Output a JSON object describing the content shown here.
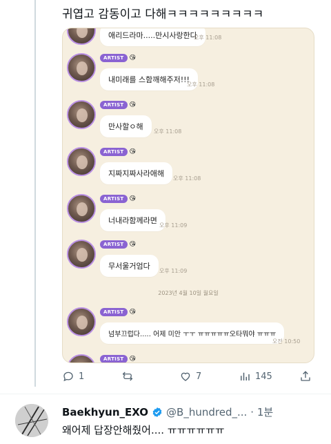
{
  "tweet": {
    "text": "귀엽고 감동이고 다해ㅋㅋㅋㅋㅋㅋㅋㅋㅋ"
  },
  "chat": {
    "badge_label": "ARTIST",
    "badge_emoji": "😘",
    "messages": [
      {
        "text": "애리드라마.....만시사랑한다",
        "time": "오후 11:08"
      },
      {
        "text": "내미래를 스함깨해주저!!!",
        "time": "오후 11:08"
      },
      {
        "text": "만사할ㅇ해",
        "time": "오후 11:08"
      },
      {
        "text": "지짜지짜사라애해",
        "time": "오후 11:08"
      },
      {
        "text": "너내라함께라면",
        "time": "오후 11:09"
      },
      {
        "text": "무서울거엄다",
        "time": "오후 11:09"
      },
      {
        "text": "넘부끄럽다..... 어제 미안 ㅜㅜ ㅠㅠㅠㅠㅠ오타뭐야 ㅠㅠㅠ",
        "time": "오전 10:50"
      }
    ],
    "date_separator": "2023년 4월 10일 월요일"
  },
  "actions": {
    "replies": "1",
    "retweets": "",
    "likes": "7",
    "views": "145"
  },
  "reply": {
    "name": "Baekhyun_EXO",
    "handle": "@B_hundred_...",
    "time": "· 1분",
    "text": "왜어제 답장안해줬어.... ㅠㅠㅠㅠㅠㅠ"
  },
  "colors": {
    "artist_badge": "#8a63d2",
    "chat_background": "#f6efe0",
    "verified": "#1d9bf0"
  }
}
